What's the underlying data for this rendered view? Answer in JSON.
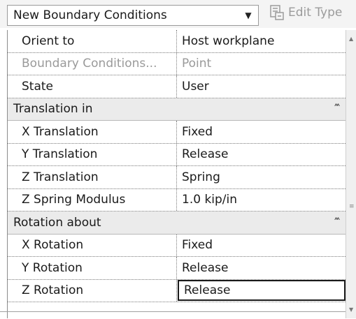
{
  "type_selector": {
    "label": "New Boundary Conditions"
  },
  "edit_type": {
    "label": "Edit Type"
  },
  "properties": [
    {
      "kind": "prop",
      "name": "Orient to",
      "value": "Host workplane"
    },
    {
      "kind": "prop",
      "name": "Boundary Conditions...",
      "value": "Point",
      "disabled": true
    },
    {
      "kind": "prop",
      "name": "State",
      "value": "User"
    },
    {
      "kind": "group",
      "name": "Translation in"
    },
    {
      "kind": "prop",
      "name": "X Translation",
      "value": "Fixed"
    },
    {
      "kind": "prop",
      "name": "Y Translation",
      "value": "Release"
    },
    {
      "kind": "prop",
      "name": "Z Translation",
      "value": "Spring"
    },
    {
      "kind": "prop",
      "name": "Z Spring Modulus",
      "value": "1.0 kip/in"
    },
    {
      "kind": "group",
      "name": "Rotation about"
    },
    {
      "kind": "prop",
      "name": "X Rotation",
      "value": "Fixed"
    },
    {
      "kind": "prop",
      "name": "Y Rotation",
      "value": "Release"
    },
    {
      "kind": "prop",
      "name": "Z Rotation",
      "value": "Release",
      "editing": true
    }
  ],
  "icons": {
    "dropdown": "chevron-down-icon",
    "edit_type": "edit-type-icon",
    "collapse": "collapse-chevron-up-icon",
    "scroll_grip": "scroll-grip-icon"
  }
}
